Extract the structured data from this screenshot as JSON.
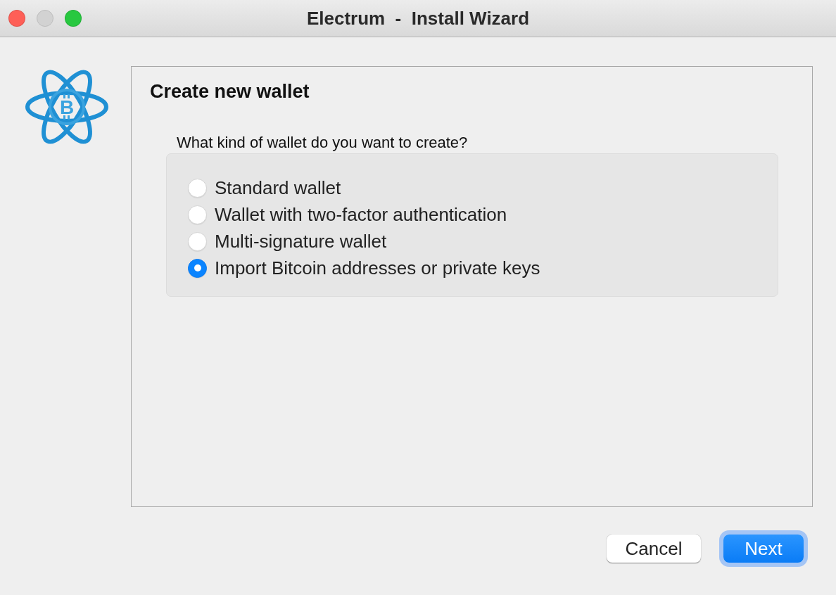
{
  "window": {
    "title": "Electrum  -  Install Wizard",
    "controls": [
      {
        "kind": "close",
        "disabled": false
      },
      {
        "kind": "minimize",
        "disabled": true
      },
      {
        "kind": "zoom",
        "disabled": false
      }
    ]
  },
  "logo": {
    "symbol": "B"
  },
  "page": {
    "heading": "Create new wallet",
    "question": "What kind of wallet do you want to create?"
  },
  "options": [
    {
      "label": "Standard wallet",
      "selected": false
    },
    {
      "label": "Wallet with two-factor authentication",
      "selected": false
    },
    {
      "label": "Multi-signature wallet",
      "selected": false
    },
    {
      "label": "Import Bitcoin addresses or private keys",
      "selected": true
    }
  ],
  "buttons": [
    {
      "label": "Cancel",
      "kind": "secondary",
      "focused": false
    },
    {
      "label": "Next",
      "kind": "default",
      "focused": true
    }
  ]
}
